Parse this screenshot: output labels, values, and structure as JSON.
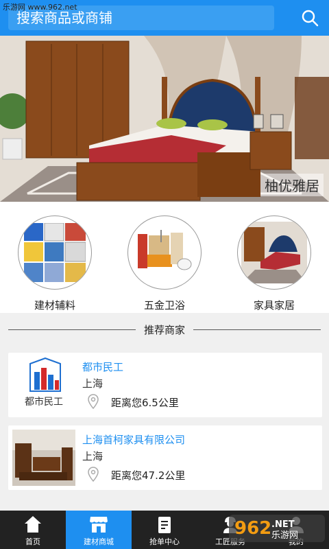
{
  "watermark_top": "乐游网 www.962.net",
  "search": {
    "placeholder": "搜索商品或商铺"
  },
  "banner": {
    "caption": "柚优雅居"
  },
  "categories": [
    {
      "label": "建材辅料",
      "icon": "building-materials-image"
    },
    {
      "label": "五金卫浴",
      "icon": "hardware-bathroom-image"
    },
    {
      "label": "家具家居",
      "icon": "furniture-bedroom-image"
    }
  ],
  "recommend": {
    "title": "推荐商家"
  },
  "merchants": [
    {
      "name": "都市民工",
      "city": "上海",
      "distance": "距离您6.5公里",
      "logo_text": "都市民工"
    },
    {
      "name": "上海首柯家具有限公司",
      "city": "上海",
      "distance": "距离您47.2公里"
    }
  ],
  "tabs": [
    {
      "label": "首页",
      "icon": "home-icon"
    },
    {
      "label": "建材商城",
      "icon": "store-icon",
      "active": true
    },
    {
      "label": "抢单中心",
      "icon": "clipboard-icon"
    },
    {
      "label": "工匠服务",
      "icon": "worker-icon"
    },
    {
      "label": "我的",
      "icon": "user-icon"
    }
  ],
  "watermark_logo": {
    "brand": "962",
    "suffix": ".NET",
    "subtitle": "乐游网"
  },
  "colors": {
    "accent": "#1e8ff0",
    "tabbar": "#222222",
    "background": "#f0f0f0"
  }
}
